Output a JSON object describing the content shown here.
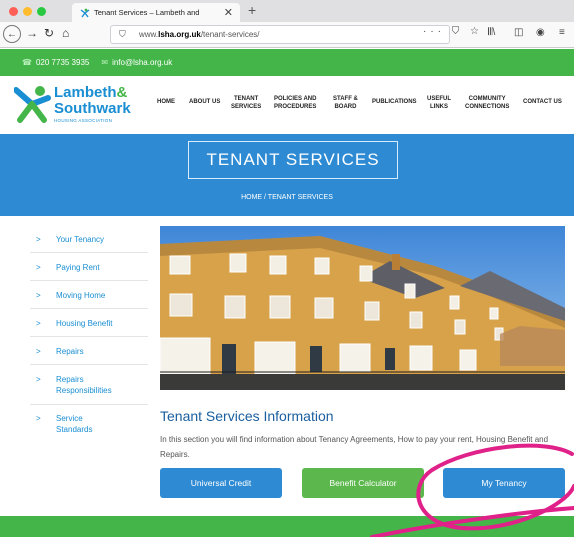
{
  "browser": {
    "tab_title": "Tenant Services – Lambeth and",
    "tab_close": "✕",
    "new_tab": "+",
    "url_prefix": "www.",
    "url_host": "lsha.org.uk",
    "url_path": "/tenant-services/",
    "url_actions": "··· ⛉ ☆"
  },
  "contact": {
    "phone": "020 7735 3935",
    "email": "info@lsha.org.uk"
  },
  "logo": {
    "line1": "Lambeth",
    "amp": "&",
    "line2": "Southwark",
    "line3": "HOUSING ASSOCIATION"
  },
  "nav": {
    "items": [
      {
        "label": "HOME"
      },
      {
        "label": "ABOUT US"
      },
      {
        "label": "TENANT\nSERVICES"
      },
      {
        "label": "POLICIES AND\nPROCEDURES"
      },
      {
        "label": "STAFF &\nBOARD"
      },
      {
        "label": "PUBLICATIONS"
      },
      {
        "label": "USEFUL\nLINKS"
      },
      {
        "label": "COMMUNITY\nCONNECTIONS"
      },
      {
        "label": "CONTACT US"
      }
    ]
  },
  "hero": {
    "title": "TENANT SERVICES",
    "breadcrumb": "HOME  /  TENANT SERVICES"
  },
  "sidebar": {
    "items": [
      {
        "label": "Your Tenancy"
      },
      {
        "label": "Paying Rent"
      },
      {
        "label": "Moving Home"
      },
      {
        "label": "Housing Benefit"
      },
      {
        "label": "Repairs"
      },
      {
        "label": "Repairs Responsibilities"
      },
      {
        "label": "Service Standards"
      }
    ]
  },
  "main": {
    "title": "Tenant Services Information",
    "description": "In this section you will find information about Tenancy Agreements, How to pay your rent, Housing Benefit and Repairs.",
    "buttons": [
      {
        "label": "Universal Credit"
      },
      {
        "label": "Benefit Calculator"
      },
      {
        "label": "My Tenancy"
      }
    ]
  },
  "colors": {
    "green": "#44b649",
    "blue": "#2e8bd3",
    "annotation": "#e0218a"
  }
}
